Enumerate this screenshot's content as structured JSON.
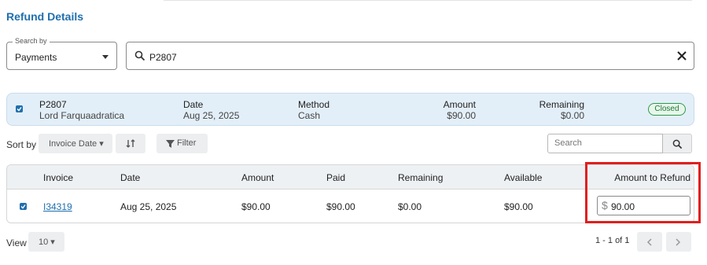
{
  "title": "Refund Details",
  "search_by": {
    "label": "Search by",
    "value": "Payments"
  },
  "search": {
    "value": "P2807"
  },
  "payment": {
    "id": "P2807",
    "customer": "Lord Farquaadratica",
    "date_label": "Date",
    "date": "Aug 25, 2025",
    "method_label": "Method",
    "method": "Cash",
    "amount_label": "Amount",
    "amount": "$90.00",
    "remaining_label": "Remaining",
    "remaining": "$0.00",
    "status": "Closed",
    "status_color": "#2e9a4a"
  },
  "sort": {
    "label": "Sort by",
    "field": "Invoice Date ▾",
    "filter_label": "Filter"
  },
  "table_search": {
    "placeholder": "Search"
  },
  "table": {
    "columns": [
      "Invoice",
      "Date",
      "Amount",
      "Paid",
      "Remaining",
      "Available",
      "Amount to Refund"
    ],
    "rows": [
      {
        "invoice": "I34319",
        "date": "Aug 25, 2025",
        "amount": "$90.00",
        "paid": "$90.00",
        "remaining": "$0.00",
        "available": "$90.00",
        "currency": "$",
        "refund": "90.00"
      }
    ]
  },
  "footer": {
    "view_label": "View",
    "page_size": "10 ▾",
    "page_info": "1 - 1 of 1"
  },
  "colors": {
    "accent": "#1f6fae",
    "highlight": "#e01f1f",
    "card_bg": "#e3eff8"
  }
}
